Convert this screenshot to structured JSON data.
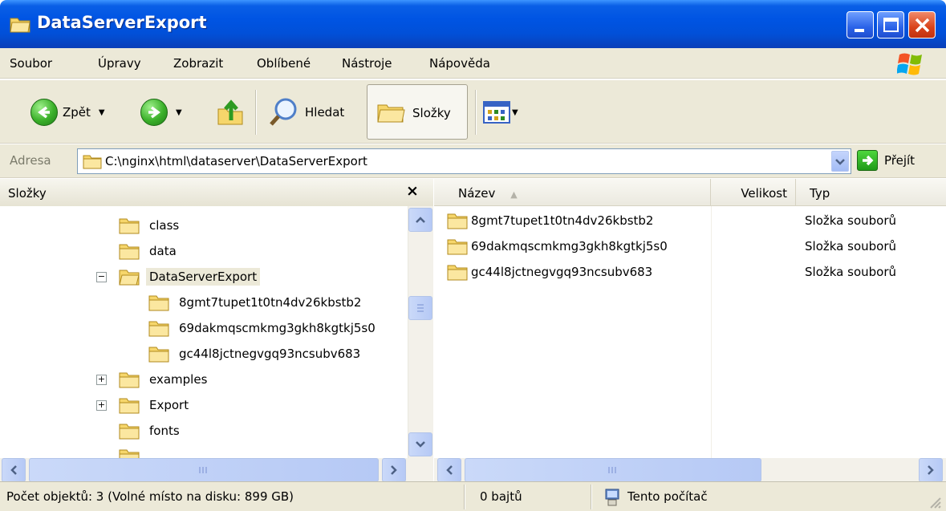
{
  "window": {
    "title": "DataServerExport"
  },
  "menu": [
    "Soubor",
    "Úpravy",
    "Zobrazit",
    "Oblíbené",
    "Nástroje",
    "Nápověda"
  ],
  "toolbar": {
    "back_label": "Zpět",
    "search_label": "Hledat",
    "folders_label": "Složky"
  },
  "address": {
    "label": "Adresa",
    "path": "C:\\nginx\\html\\dataserver\\DataServerExport",
    "go_label": "Přejít"
  },
  "folders_pane": {
    "title": "Složky",
    "close": "×",
    "tree": [
      {
        "label": "class",
        "level": 0,
        "expander": ""
      },
      {
        "label": "data",
        "level": 0,
        "expander": ""
      },
      {
        "label": "DataServerExport",
        "level": 0,
        "expander": "−",
        "selected": true
      },
      {
        "label": "8gmt7tupet1t0tn4dv26kbstb2",
        "level": 1,
        "expander": ""
      },
      {
        "label": "69dakmqscmkmg3gkh8kgtkj5s0",
        "level": 1,
        "expander": ""
      },
      {
        "label": "gc44l8jctnegvgq93ncsubv683",
        "level": 1,
        "expander": ""
      },
      {
        "label": "examples",
        "level": 0,
        "expander": "+"
      },
      {
        "label": "Export",
        "level": 0,
        "expander": "+"
      },
      {
        "label": "fonts",
        "level": 0,
        "expander": ""
      }
    ]
  },
  "file_list": {
    "columns": {
      "name": "Název",
      "size": "Velikost",
      "type": "Typ"
    },
    "rows": [
      {
        "name": "8gmt7tupet1t0tn4dv26kbstb2",
        "size": "",
        "type": "Složka souborů"
      },
      {
        "name": "69dakmqscmkmg3gkh8kgtkj5s0",
        "size": "",
        "type": "Složka souborů"
      },
      {
        "name": "gc44l8jctnegvgq93ncsubv683",
        "size": "",
        "type": "Složka souborů"
      }
    ]
  },
  "status": {
    "objects": "Počet objektů: 3 (Volné místo na disku: 899 GB)",
    "size": "0 bajtů",
    "location": "Tento počítač"
  },
  "colors": {
    "titlebar": "#0054e3",
    "chrome": "#ece9d8",
    "folder": "#f6d66b"
  }
}
